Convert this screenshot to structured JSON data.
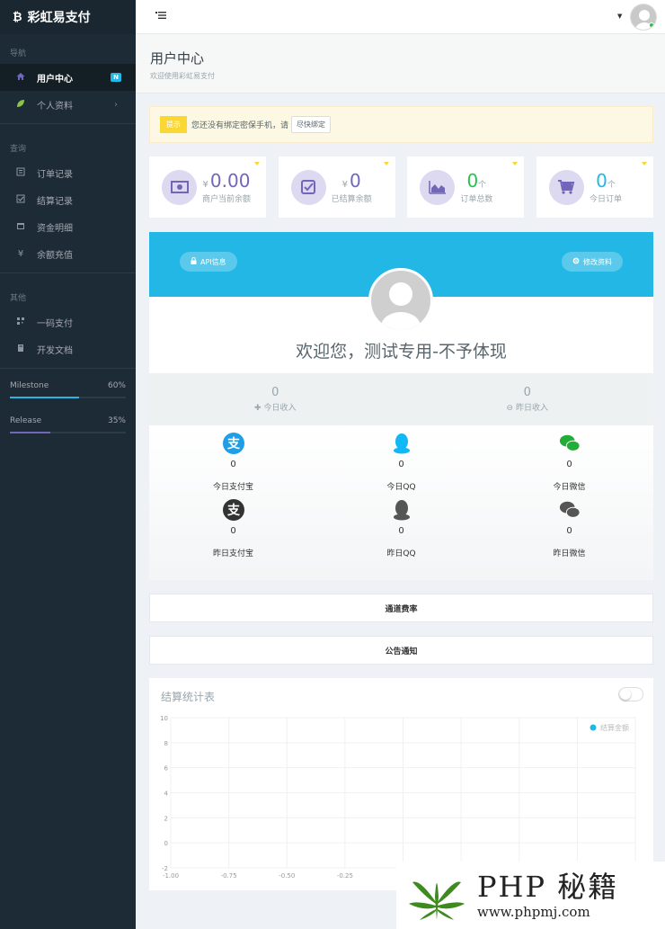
{
  "brand": {
    "logo": "₿",
    "name": "彩虹易支付"
  },
  "sidebar": {
    "sections": {
      "nav": "导航",
      "query": "查询",
      "other": "其他"
    },
    "items": {
      "user_center": {
        "label": "用户中心",
        "badge": "N"
      },
      "profile": {
        "label": "个人资料"
      },
      "orders": {
        "label": "订单记录"
      },
      "settlement": {
        "label": "结算记录"
      },
      "funds": {
        "label": "资金明细"
      },
      "recharge": {
        "label": "余额充值"
      },
      "qrpay": {
        "label": "一码支付"
      },
      "docs": {
        "label": "开发文档"
      }
    },
    "progress": [
      {
        "label": "Milestone",
        "value": "60%",
        "fraction": 0.6,
        "color": "#23b7e5"
      },
      {
        "label": "Release",
        "value": "35%",
        "fraction": 0.35,
        "color": "#7266ba"
      }
    ]
  },
  "page": {
    "title": "用户中心",
    "subtitle": "欢迎使用彩虹易支付"
  },
  "notice": {
    "tag": "提示",
    "text": "您还没有绑定密保手机，请",
    "button": "尽快绑定"
  },
  "stats": {
    "balance": {
      "currency": "¥",
      "value": "0.00",
      "label": "商户当前余额"
    },
    "settled": {
      "currency": "¥",
      "value": "0",
      "label": "已结算余额"
    },
    "orders_total": {
      "value": "0",
      "unit": "个",
      "label": "订单总数"
    },
    "orders_today": {
      "value": "0",
      "unit": "个",
      "label": "今日订单"
    }
  },
  "profile": {
    "api_button": "API信息",
    "edit_button": "修改资料",
    "welcome": "欢迎您，测试专用-不予体现",
    "today_income": {
      "value": "0",
      "label": "今日收入"
    },
    "yesterday_income": {
      "value": "0",
      "label": "昨日收入"
    },
    "channels": {
      "today_alipay": {
        "value": "0",
        "label": "今日支付宝"
      },
      "today_qq": {
        "value": "0",
        "label": "今日QQ"
      },
      "today_wechat": {
        "value": "0",
        "label": "今日微信"
      },
      "yesterday_alipay": {
        "value": "0",
        "label": "昨日支付宝"
      },
      "yesterday_qq": {
        "value": "0",
        "label": "昨日QQ"
      },
      "yesterday_wechat": {
        "value": "0",
        "label": "昨日微信"
      }
    }
  },
  "panels": {
    "rates": "通道费率",
    "announcements": "公告通知"
  },
  "chart_panel": {
    "title": "结算统计表"
  },
  "chart_data": {
    "type": "line",
    "title": "结算统计表",
    "series": [
      {
        "name": "结算金额",
        "x": [],
        "y": []
      }
    ],
    "x_ticks": [
      "-1.00",
      "-0.75",
      "-0.50",
      "-0.25"
    ],
    "y_ticks": [
      "10",
      "8",
      "6",
      "4",
      "2",
      "0",
      "-2"
    ],
    "xlim": [
      -1,
      1
    ],
    "ylim": [
      -2,
      10
    ],
    "grid": true,
    "legend_position": "top-right",
    "colors": {
      "legend_dot": "#23b7e5"
    }
  },
  "watermark": {
    "text": "PHP 秘籍",
    "url": "www.phpmj.com"
  },
  "colors": {
    "sidebar": "#1c2b36",
    "primary": "#7266ba",
    "info": "#23b7e5",
    "success": "#27c24c",
    "warning": "#fad733"
  }
}
